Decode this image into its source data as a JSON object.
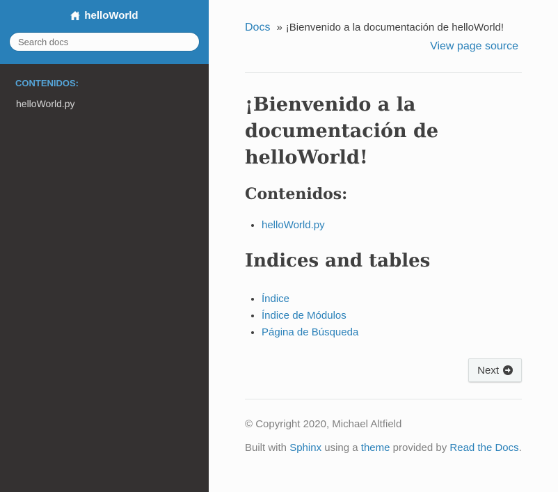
{
  "sidebar": {
    "brand": "helloWorld",
    "search_placeholder": "Search docs",
    "caption": "CONTENIDOS:",
    "items": [
      {
        "label": "helloWorld.py"
      }
    ]
  },
  "breadcrumbs": {
    "docs": "Docs",
    "separator": "»",
    "current": "¡Bienvenido a la documentación de helloWorld!"
  },
  "view_source": "View page source",
  "main": {
    "title": "¡Bienvenido a la documentación de helloWorld!",
    "contents_heading": "Contenidos:",
    "toc_items": [
      "helloWorld.py"
    ],
    "indices_heading": "Indices and tables",
    "index_links": [
      "Índice",
      "Índice de Módulos",
      "Página de Búsqueda"
    ]
  },
  "next_button": "Next",
  "footer": {
    "copyright": "© Copyright 2020, Michael Altfield",
    "built_prefix": "Built with",
    "sphinx": "Sphinx",
    "using_a": "using a",
    "theme": "theme",
    "provided_by": "provided by",
    "rtd": "Read the Docs",
    "period": "."
  },
  "colors": {
    "sidebar_bg": "#343131",
    "sidebar_top": "#2980b9",
    "link": "#2980b9",
    "caption": "#55a5d9"
  },
  "icons": {
    "brand": "home-icon",
    "next": "circle-arrow-right-icon"
  }
}
